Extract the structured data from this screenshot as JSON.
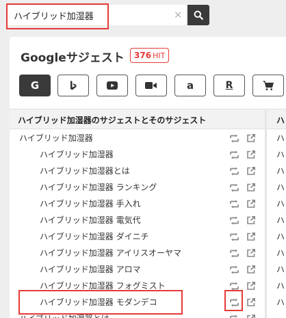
{
  "search": {
    "value": "ハイブリッド加湿器",
    "clear_glyph": "✕"
  },
  "panel": {
    "title": "Googleサジェスト",
    "hit_count": "376",
    "hit_label": "HIT"
  },
  "engines": [
    {
      "name": "google",
      "glyph": "G"
    },
    {
      "name": "bing",
      "glyph": "b"
    },
    {
      "name": "youtube",
      "glyph": "▶"
    },
    {
      "name": "video",
      "glyph": "■"
    },
    {
      "name": "amazon",
      "glyph": "a"
    },
    {
      "name": "rakuten",
      "glyph": "R"
    },
    {
      "name": "shopping",
      "glyph": "cart"
    }
  ],
  "table": {
    "header": "ハイブリッド加湿器のサジェストとそのサジェスト"
  },
  "rows": [
    {
      "text": "ハイブリッド加湿器",
      "indent": false
    },
    {
      "text": "ハイブリッド加湿器",
      "indent": true
    },
    {
      "text": "ハイブリッド加湿器とは",
      "indent": true
    },
    {
      "text": "ハイブリッド加湿器 ランキング",
      "indent": true
    },
    {
      "text": "ハイブリッド加湿器 手入れ",
      "indent": true
    },
    {
      "text": "ハイブリッド加湿器 電気代",
      "indent": true
    },
    {
      "text": "ハイブリッド加湿器 ダイニチ",
      "indent": true
    },
    {
      "text": "ハイブリッド加湿器 アイリスオーヤマ",
      "indent": true
    },
    {
      "text": "ハイブリッド加湿器 アロマ",
      "indent": true
    },
    {
      "text": "ハイブリッド加湿器 フォグミスト",
      "indent": true
    },
    {
      "text": "ハイブリッド加湿器 モダンデコ",
      "indent": true
    },
    {
      "text": "ハイブリッド加湿器とは",
      "indent": false
    }
  ],
  "second_col": {
    "header": "ハ",
    "cells": [
      "ハ",
      "ハ",
      "ハ",
      "ハ",
      "ハ",
      "ハ",
      "ハ",
      "ハ",
      "ハ",
      "ハ",
      "ハ"
    ]
  },
  "colors": {
    "accent_red": "#e53935",
    "dark": "#3a3a3a",
    "icon_gray": "#888888"
  }
}
